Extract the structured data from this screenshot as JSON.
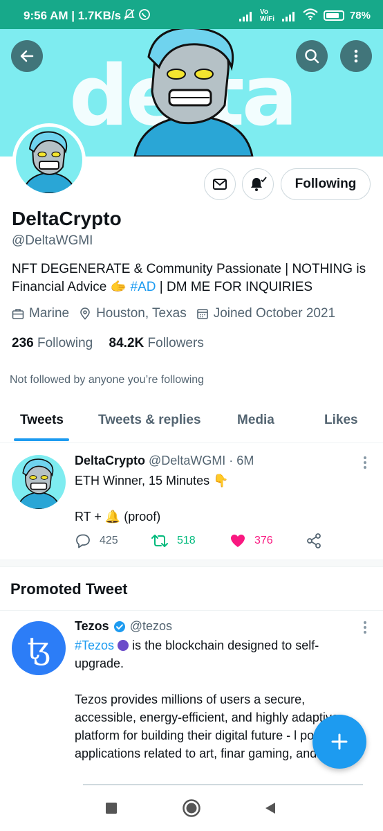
{
  "status_bar": {
    "time": "9:56 AM | 1.7KB/s",
    "network_label": "Vo WiFi",
    "battery": "78%"
  },
  "banner": {
    "text": "delta"
  },
  "profile": {
    "name": "DeltaCrypto",
    "handle": "@DeltaWGMI",
    "bio_part1": "NFT DEGENERATE & Community Passionate | NOTHING is Financial Advice ",
    "bio_emoji": "🫱",
    "bio_hashtag": "#AD",
    "bio_part2": " | DM ME FOR INQUIRIES",
    "location_work": "Marine",
    "location": "Houston, Texas",
    "joined": "Joined October 2021",
    "following_count": "236",
    "following_label": "Following",
    "followers_count": "84.2K",
    "followers_label": "Followers",
    "not_followed": "Not followed by anyone you’re following",
    "following_button": "Following"
  },
  "tabs": [
    "Tweets",
    "Tweets & replies",
    "Media",
    "Likes"
  ],
  "tweet": {
    "author": "DeltaCrypto",
    "handle_time": "@DeltaWGMI · 6M",
    "line1": "ETH Winner, 15 Minutes 👇",
    "line2": "RT + 🔔 (proof)",
    "replies": "425",
    "retweets": "518",
    "likes": "376"
  },
  "promoted": {
    "title": "Promoted Tweet",
    "author": "Tezos",
    "handle": "@tezos",
    "avatar_letter": "ꜩ",
    "hashtag": "#Tezos",
    "line1": " is the blockchain designed to self-upgrade.",
    "para2": "Tezos provides millions of users a secure, accessible, energy-efficient, and highly adaptive platform for building their digital future - l powering applications related to art, finar gaming, and more."
  },
  "colors": {
    "accent": "#1d9bf0",
    "banner": "#7eecf0",
    "status_bar": "#17a98a",
    "retweet": "#00ba7c",
    "like": "#f91880"
  },
  "icons": [
    "back-arrow-icon",
    "search-icon",
    "more-vertical-icon",
    "mail-icon",
    "bell-icon",
    "briefcase-icon",
    "location-pin-icon",
    "calendar-icon",
    "reply-icon",
    "retweet-icon",
    "heart-icon",
    "share-icon",
    "plus-icon",
    "verified-badge-icon"
  ]
}
